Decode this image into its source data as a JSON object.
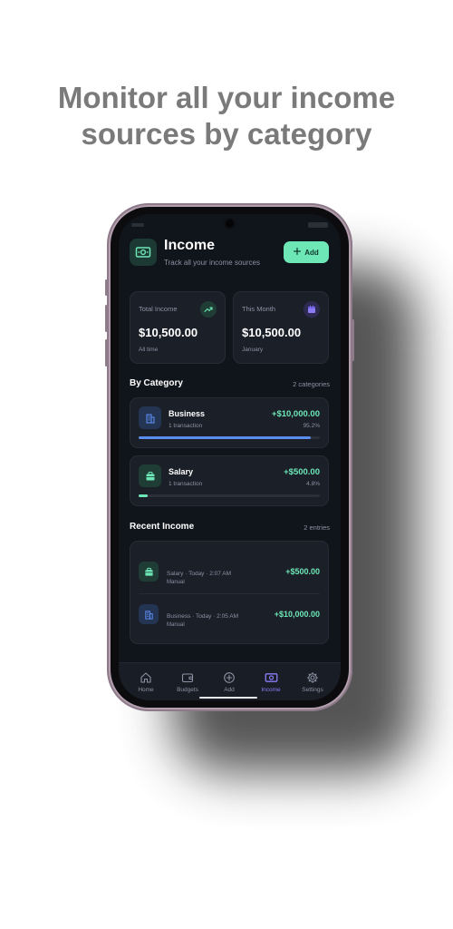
{
  "headline": {
    "line1": "Monitor all your income",
    "line2": "sources by category"
  },
  "colors": {
    "accent": "#6ee7b7",
    "nav_active": "#8b7cf6",
    "business": "#5b8def",
    "background": "#10141b"
  },
  "header": {
    "icon": "money-icon",
    "title": "Income",
    "subtitle": "Track all your income sources",
    "add_label": "Add"
  },
  "stats": [
    {
      "label": "Total Income",
      "value": "$10,500.00",
      "note": "All time",
      "icon": "trending-up-icon"
    },
    {
      "label": "This Month",
      "value": "$10,500.00",
      "note": "January",
      "icon": "calendar-icon"
    }
  ],
  "by_category": {
    "title": "By Category",
    "meta": "2 categories",
    "items": [
      {
        "name": "Business",
        "count": "1 transaction",
        "amount": "+$10,000.00",
        "percent": "95.2%",
        "share": 0.952,
        "icon": "building-icon"
      },
      {
        "name": "Salary",
        "count": "1 transaction",
        "amount": "+$500.00",
        "percent": "4.8%",
        "share": 0.048,
        "icon": "briefcase-icon"
      }
    ]
  },
  "recent": {
    "title": "Recent Income",
    "meta": "2 entries",
    "items": [
      {
        "line": "Salary · Today · 2:07 AM",
        "sub": "Manual",
        "amount": "+$500.00",
        "icon": "briefcase-icon"
      },
      {
        "line": "Business · Today · 2:05 AM",
        "sub": "Manual",
        "amount": "+$10,000.00",
        "icon": "building-icon"
      }
    ]
  },
  "nav": [
    {
      "label": "Home",
      "icon": "home-icon",
      "active": false
    },
    {
      "label": "Budgets",
      "icon": "wallet-icon",
      "active": false
    },
    {
      "label": "Add",
      "icon": "plus-circle-icon",
      "active": false
    },
    {
      "label": "Income",
      "icon": "money-icon",
      "active": true
    },
    {
      "label": "Settings",
      "icon": "gear-icon",
      "active": false
    }
  ]
}
